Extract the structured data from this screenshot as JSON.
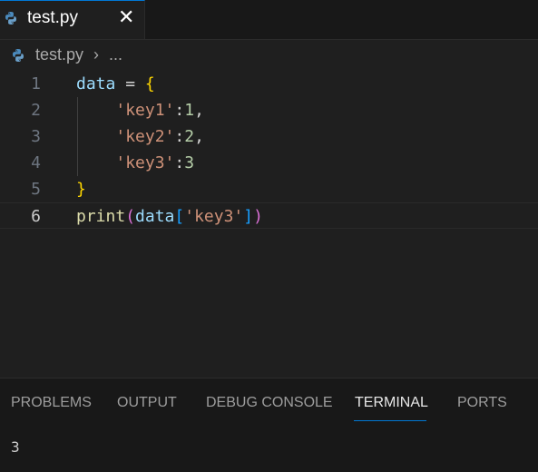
{
  "tab": {
    "label": "test.py",
    "close_glyph": "✕",
    "icon": "python-icon"
  },
  "breadcrumb": {
    "file": "test.py",
    "separator": "›",
    "more": "..."
  },
  "editor": {
    "line_numbers": [
      "1",
      "2",
      "3",
      "4",
      "5",
      "6"
    ],
    "active_line": "6",
    "code": {
      "l1_var": "data",
      "l1_op": " = ",
      "l1_brace": "{",
      "l2_indent": "    ",
      "l2_str": "'key1'",
      "l2_colon": ":",
      "l2_num": "1",
      "l2_comma": ",",
      "l3_indent": "    ",
      "l3_str": "'key2'",
      "l3_colon": ":",
      "l3_num": "2",
      "l3_comma": ",",
      "l4_indent": "    ",
      "l4_str": "'key3'",
      "l4_colon": ":",
      "l4_num": "3",
      "l5_brace": "}",
      "l6_fn": "print",
      "l6_paren_open": "(",
      "l6_var": "data",
      "l6_bracket_open": "[",
      "l6_str": "'key3'",
      "l6_bracket_close": "]",
      "l6_paren_close": ")"
    }
  },
  "panel": {
    "tabs": {
      "problems": "PROBLEMS",
      "output": "OUTPUT",
      "debug_console": "DEBUG CONSOLE",
      "terminal": "TERMINAL",
      "ports": "PORTS"
    },
    "active_tab": "TERMINAL",
    "terminal_output": "3"
  },
  "colors": {
    "accent": "#0078d4",
    "editor_bg": "#1f1f1f",
    "panel_bg": "#181818"
  }
}
